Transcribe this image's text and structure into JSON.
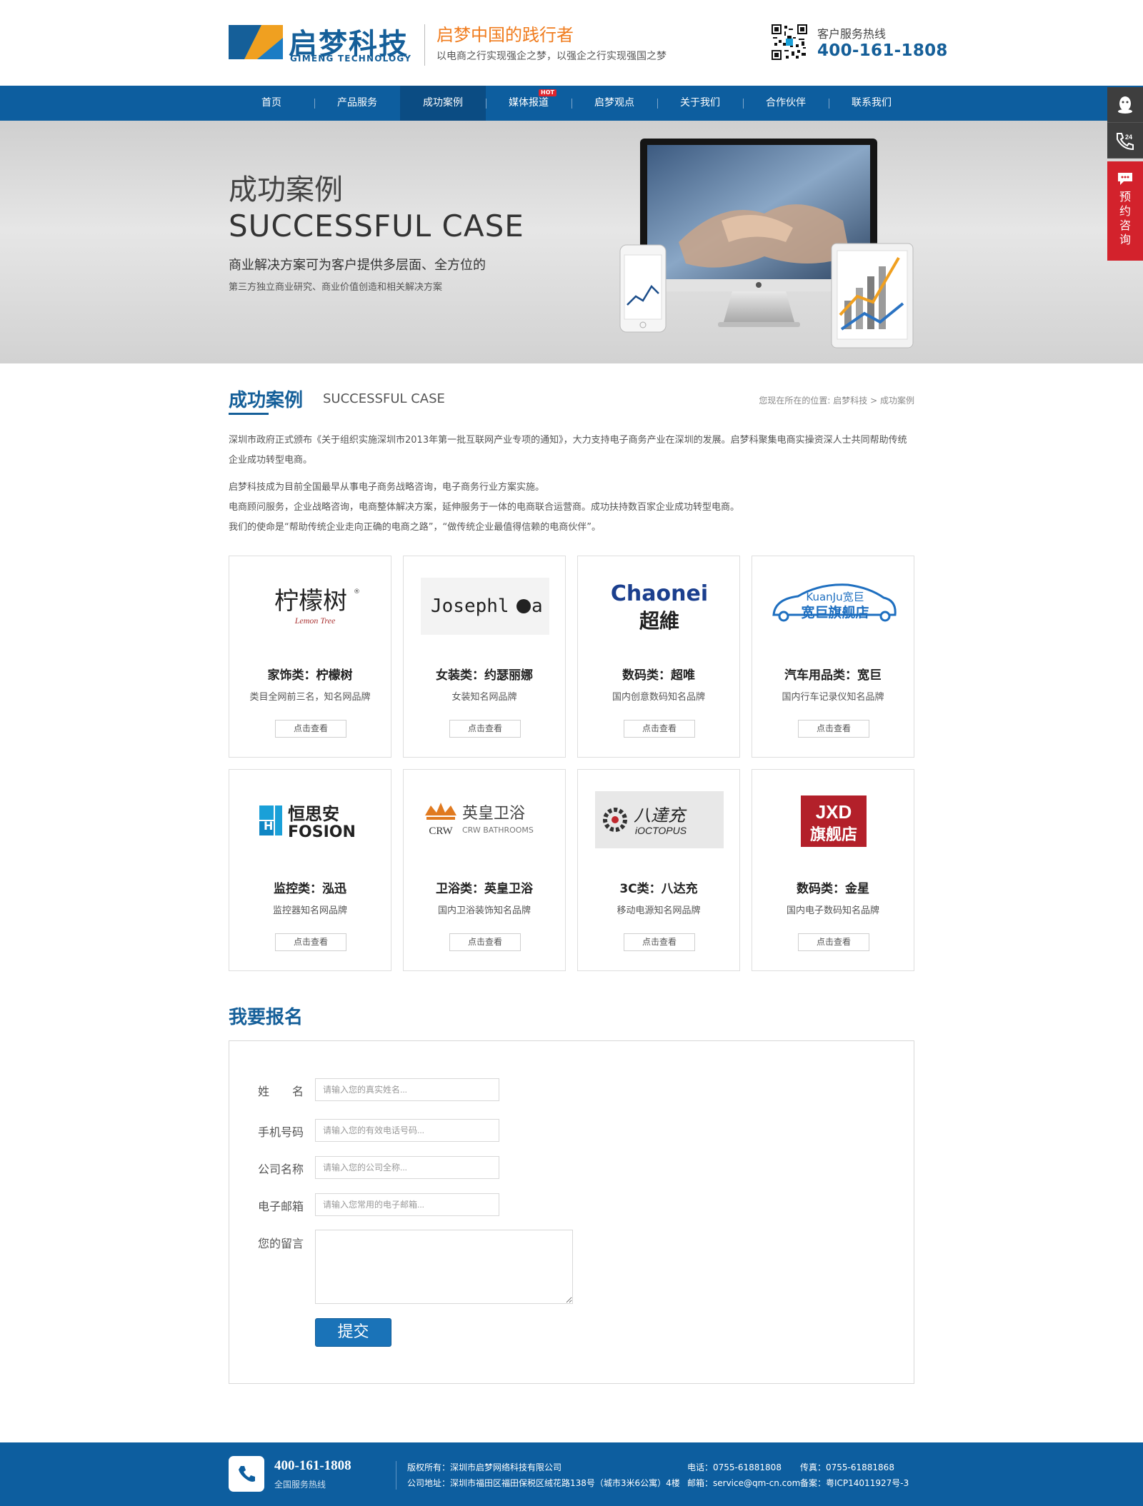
{
  "header": {
    "logo_cn": "启梦科技",
    "logo_en": "GIMENG TECHNOLOGY",
    "slogan_main": "启梦中国的践行者",
    "slogan_sub": "以电商之行实现强企之梦，以强企之行实现强国之梦",
    "hotline_label": "客户服务热线",
    "hotline_number": "400-161-1808"
  },
  "nav": {
    "items": [
      {
        "label": "首页"
      },
      {
        "label": "产品服务"
      },
      {
        "label": "成功案例"
      },
      {
        "label": "媒体报道"
      },
      {
        "label": "启梦观点"
      },
      {
        "label": "关于我们"
      },
      {
        "label": "合作伙伴"
      },
      {
        "label": "联系我们"
      }
    ],
    "active_index": 2,
    "hot_badge": "HOT"
  },
  "banner": {
    "title_cn": "成功案例",
    "title_en": "SUCCESSFUL CASE",
    "desc1": "商业解决方案可为客户提供多层面、全方位的",
    "desc2": "第三方独立商业研究、商业价值创造和相关解决方案"
  },
  "float_bar": {
    "consult_label": "预约咨询",
    "icons": [
      "qq-icon",
      "phone-24-icon",
      "chat-icon"
    ]
  },
  "section": {
    "title_cn": "成功案例",
    "title_en": "SUCCESSFUL CASE",
    "breadcrumb_prefix": "您现在所在的位置:",
    "breadcrumb_home": "启梦科技",
    "breadcrumb_sep": ">",
    "breadcrumb_current": "成功案例"
  },
  "intro": {
    "p1": "深圳市政府正式颁布《关于组织实施深圳市2013年第一批互联网产业专项的通知》，大力支持电子商务产业在深圳的发展。启梦科聚集电商实操资深人士共同帮助传统企业成功转型电商。",
    "p2": "启梦科技成为目前全国最早从事电子商务战略咨询，电子商务行业方案实施。",
    "p3": "电商顾问服务，企业战略咨询，电商整体解决方案，延伸服务于一体的电商联合运营商。成功扶持数百家企业成功转型电商。",
    "p4": "我们的使命是“帮助传统企业走向正确的电商之路”，“做传统企业最值得信赖的电商伙伴”。"
  },
  "cases": [
    {
      "logo_text": "柠檬树",
      "logo_sub": "Lemon Tree",
      "title": "家饰类：柠檬树",
      "desc": "类目全网前三名，知名网品牌",
      "button": "点击查看"
    },
    {
      "logo_text": "Josephl",
      "logo_sub": "a",
      "title": "女装类：约瑟丽娜",
      "desc": "女装知名网品牌",
      "button": "点击查看"
    },
    {
      "logo_text": "Chaonei",
      "logo_sub": "超維",
      "title": "数码类：超唯",
      "desc": "国内创意数码知名品牌",
      "button": "点击查看"
    },
    {
      "logo_text": "KuanJu宽巨",
      "logo_sub": "宽巨旗舰店",
      "title": "汽车用品类：宽巨",
      "desc": "国内行车记录仪知名品牌",
      "button": "点击查看"
    },
    {
      "logo_text": "恒思安",
      "logo_sub": "FOSION",
      "title": "监控类：泓迅",
      "desc": "监控器知名网品牌",
      "button": "点击查看"
    },
    {
      "logo_text": "英皇卫浴",
      "logo_sub": "CRW BATHROOMS",
      "title": "卫浴类：英皇卫浴",
      "desc": "国内卫浴装饰知名品牌",
      "button": "点击查看"
    },
    {
      "logo_text": "八達充",
      "logo_sub": "iOCTOPUS",
      "title": "3C类：八达充",
      "desc": "移动电源知名网品牌",
      "button": "点击查看"
    },
    {
      "logo_text": "JXD",
      "logo_sub": "旗舰店",
      "title": "数码类：金星",
      "desc": "国内电子数码知名品牌",
      "button": "点击查看"
    }
  ],
  "form": {
    "title": "我要报名",
    "name_label": "姓　　名",
    "name_placeholder": "请输入您的真实姓名...",
    "phone_label": "手机号码",
    "phone_placeholder": "请输入您的有效电话号码...",
    "company_label": "公司名称",
    "company_placeholder": "请输入您的公司全称...",
    "email_label": "电子邮箱",
    "email_placeholder": "请输入您常用的电子邮箱...",
    "message_label": "您的留言",
    "submit_label": "提交"
  },
  "footer": {
    "phone": "400-161-1808",
    "phone_label": "全国服务热线",
    "copyright": "版权所有：深圳市启梦网络科技有限公司",
    "address": "公司地址：深圳市福田区福田保税区绒花路138号（城市3米6公寓）4楼",
    "tel": "电话：0755-61881808",
    "email": "邮箱：service@qm-cn.com",
    "fax": "传真：0755-61881868",
    "icp": "备案：粤ICP14011927号-3"
  },
  "colors": {
    "brand_blue": "#0d5e9f",
    "accent_orange": "#f07c1e",
    "consult_red": "#d3222c"
  }
}
